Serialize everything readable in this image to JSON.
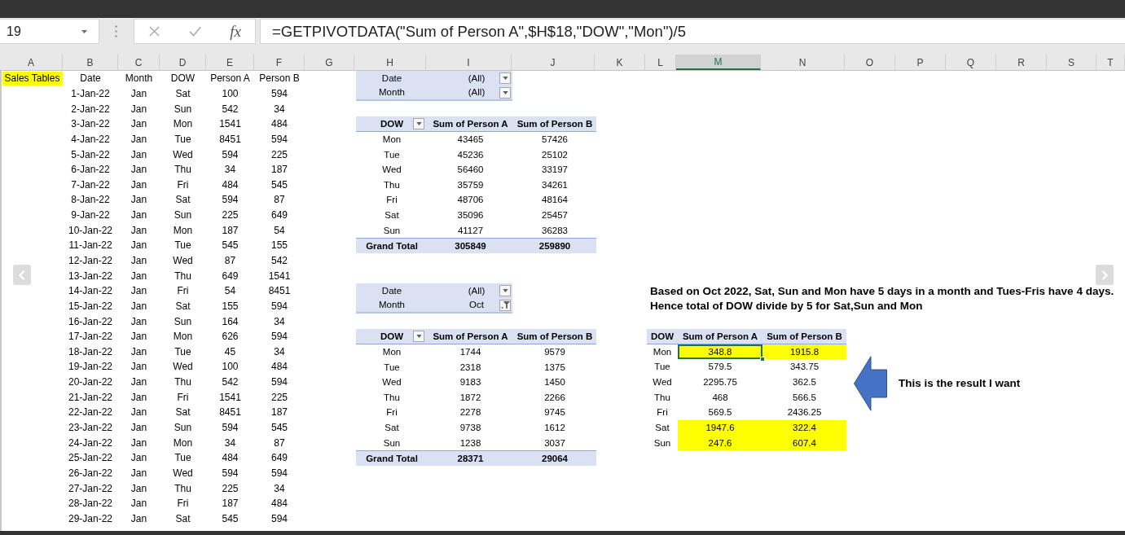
{
  "formula_bar": {
    "name_box": "19",
    "buttons": [
      {
        "kind": "cancel",
        "disabled": true
      },
      {
        "kind": "enter",
        "disabled": true
      },
      {
        "kind": "function",
        "label": "fx"
      }
    ],
    "formula": "=GETPIVOTDATA(\"Sum of Person A\",$H$18,\"DOW\",\"Mon\")/5"
  },
  "column_headers": [
    {
      "label": "A",
      "selected": false
    },
    {
      "label": "B",
      "selected": false
    },
    {
      "label": "C",
      "selected": false
    },
    {
      "label": "D",
      "selected": false
    },
    {
      "label": "E",
      "selected": false
    },
    {
      "label": "F",
      "selected": false
    },
    {
      "label": "G",
      "selected": false
    },
    {
      "label": "H",
      "selected": false
    },
    {
      "label": "I",
      "selected": false
    },
    {
      "label": "J",
      "selected": false
    },
    {
      "label": "K",
      "selected": false
    },
    {
      "label": "L",
      "selected": false
    },
    {
      "label": "M",
      "selected": true
    },
    {
      "label": "N",
      "selected": false
    },
    {
      "label": "O",
      "selected": false
    },
    {
      "label": "P",
      "selected": false
    },
    {
      "label": "Q",
      "selected": false
    },
    {
      "label": "R",
      "selected": false
    },
    {
      "label": "S",
      "selected": false
    },
    {
      "label": "T",
      "selected": false
    }
  ],
  "sales_table": {
    "title": "Sales Tables",
    "columns": [
      "Date",
      "Month",
      "DOW",
      "Person A",
      "Person B"
    ],
    "rows": [
      [
        "1-Jan-22",
        "Jan",
        "Sat",
        "100",
        "594"
      ],
      [
        "2-Jan-22",
        "Jan",
        "Sun",
        "542",
        "34"
      ],
      [
        "3-Jan-22",
        "Jan",
        "Mon",
        "1541",
        "484"
      ],
      [
        "4-Jan-22",
        "Jan",
        "Tue",
        "8451",
        "594"
      ],
      [
        "5-Jan-22",
        "Jan",
        "Wed",
        "594",
        "225"
      ],
      [
        "6-Jan-22",
        "Jan",
        "Thu",
        "34",
        "187"
      ],
      [
        "7-Jan-22",
        "Jan",
        "Fri",
        "484",
        "545"
      ],
      [
        "8-Jan-22",
        "Jan",
        "Sat",
        "594",
        "87"
      ],
      [
        "9-Jan-22",
        "Jan",
        "Sun",
        "225",
        "649"
      ],
      [
        "10-Jan-22",
        "Jan",
        "Mon",
        "187",
        "54"
      ],
      [
        "11-Jan-22",
        "Jan",
        "Tue",
        "545",
        "155"
      ],
      [
        "12-Jan-22",
        "Jan",
        "Wed",
        "87",
        "542"
      ],
      [
        "13-Jan-22",
        "Jan",
        "Thu",
        "649",
        "1541"
      ],
      [
        "14-Jan-22",
        "Jan",
        "Fri",
        "54",
        "8451"
      ],
      [
        "15-Jan-22",
        "Jan",
        "Sat",
        "155",
        "594"
      ],
      [
        "16-Jan-22",
        "Jan",
        "Sun",
        "164",
        "34"
      ],
      [
        "17-Jan-22",
        "Jan",
        "Mon",
        "626",
        "594"
      ],
      [
        "18-Jan-22",
        "Jan",
        "Tue",
        "45",
        "34"
      ],
      [
        "19-Jan-22",
        "Jan",
        "Wed",
        "100",
        "484"
      ],
      [
        "20-Jan-22",
        "Jan",
        "Thu",
        "542",
        "594"
      ],
      [
        "21-Jan-22",
        "Jan",
        "Fri",
        "1541",
        "225"
      ],
      [
        "22-Jan-22",
        "Jan",
        "Sat",
        "8451",
        "187"
      ],
      [
        "23-Jan-22",
        "Jan",
        "Sun",
        "594",
        "545"
      ],
      [
        "24-Jan-22",
        "Jan",
        "Mon",
        "34",
        "87"
      ],
      [
        "25-Jan-22",
        "Jan",
        "Tue",
        "484",
        "649"
      ],
      [
        "26-Jan-22",
        "Jan",
        "Wed",
        "594",
        "594"
      ],
      [
        "27-Jan-22",
        "Jan",
        "Thu",
        "225",
        "34"
      ],
      [
        "28-Jan-22",
        "Jan",
        "Fri",
        "187",
        "484"
      ],
      [
        "29-Jan-22",
        "Jan",
        "Sat",
        "545",
        "594"
      ]
    ]
  },
  "pivots": [
    {
      "filters": [
        {
          "field": "Date",
          "value": "(All)",
          "filtered": false
        },
        {
          "field": "Month",
          "value": "(All)",
          "filtered": false
        }
      ],
      "columns": [
        "DOW",
        "Sum of Person A",
        "Sum of Person B"
      ],
      "rows": [
        [
          "Mon",
          "43465",
          "57426"
        ],
        [
          "Tue",
          "45236",
          "25102"
        ],
        [
          "Wed",
          "56460",
          "33197"
        ],
        [
          "Thu",
          "35759",
          "34261"
        ],
        [
          "Fri",
          "48706",
          "48164"
        ],
        [
          "Sat",
          "35096",
          "25457"
        ],
        [
          "Sun",
          "41127",
          "36283"
        ]
      ],
      "total": [
        "Grand Total",
        "305849",
        "259890"
      ]
    },
    {
      "filters": [
        {
          "field": "Date",
          "value": "(All)",
          "filtered": false
        },
        {
          "field": "Month",
          "value": "Oct",
          "filtered": true
        }
      ],
      "columns": [
        "DOW",
        "Sum of Person A",
        "Sum of Person B"
      ],
      "rows": [
        [
          "Mon",
          "1744",
          "9579"
        ],
        [
          "Tue",
          "2318",
          "1375"
        ],
        [
          "Wed",
          "9183",
          "1450"
        ],
        [
          "Thu",
          "1872",
          "2266"
        ],
        [
          "Fri",
          "2278",
          "9745"
        ],
        [
          "Sat",
          "9738",
          "1612"
        ],
        [
          "Sun",
          "1238",
          "3037"
        ]
      ],
      "total": [
        "Grand Total",
        "28371",
        "29064"
      ]
    }
  ],
  "notes": [
    "Based on Oct 2022, Sat, Sun and Mon have 5 days in a month and Tues-Fris have 4 days.",
    "Hence total of DOW divide by 5 for Sat,Sun and Mon"
  ],
  "result_table": {
    "columns": [
      "DOW",
      "Sum of Person A",
      "Sum of Person B"
    ],
    "rows": [
      {
        "dow": "Mon",
        "highlighted": true,
        "values": [
          {
            "text": "348.8",
            "selected": true
          },
          {
            "text": "1915.8",
            "selected": false
          }
        ]
      },
      {
        "dow": "Tue",
        "highlighted": false,
        "values": [
          {
            "text": "579.5",
            "selected": false
          },
          {
            "text": "343.75",
            "selected": false
          }
        ]
      },
      {
        "dow": "Wed",
        "highlighted": false,
        "values": [
          {
            "text": "2295.75",
            "selected": false
          },
          {
            "text": "362.5",
            "selected": false
          }
        ]
      },
      {
        "dow": "Thu",
        "highlighted": false,
        "values": [
          {
            "text": "468",
            "selected": false
          },
          {
            "text": "566.5",
            "selected": false
          }
        ]
      },
      {
        "dow": "Fri",
        "highlighted": false,
        "values": [
          {
            "text": "569.5",
            "selected": false
          },
          {
            "text": "2436.25",
            "selected": false
          }
        ]
      },
      {
        "dow": "Sat",
        "highlighted": true,
        "values": [
          {
            "text": "1947.6",
            "selected": false
          },
          {
            "text": "322.4",
            "selected": false
          }
        ]
      },
      {
        "dow": "Sun",
        "highlighted": true,
        "values": [
          {
            "text": "247.6",
            "selected": false
          },
          {
            "text": "607.4",
            "selected": false
          }
        ]
      }
    ]
  },
  "callout": "This is the result I want"
}
